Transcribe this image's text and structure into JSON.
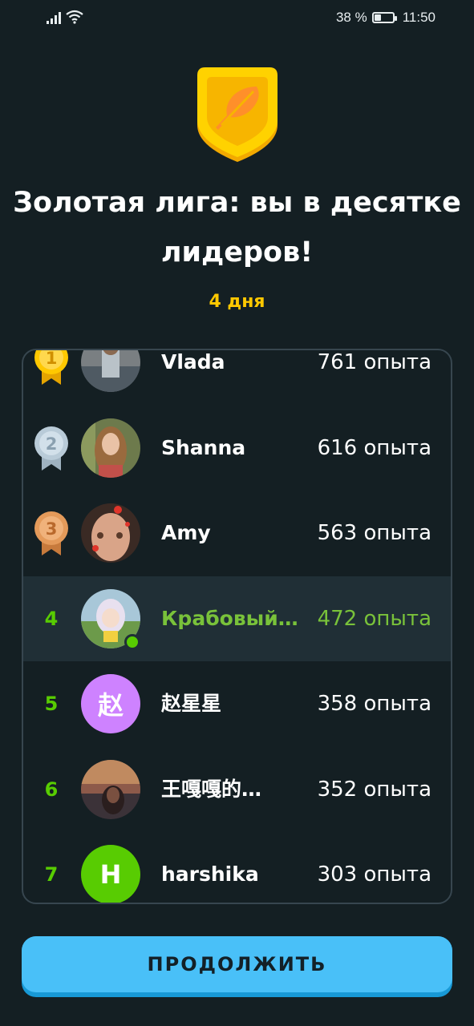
{
  "status_bar": {
    "battery": "38 %",
    "time": "11:50",
    "battery_level": 0.38
  },
  "league": {
    "title_line1": "Золотая лига: вы в десятке",
    "title_line2": "лидеров!",
    "days_left": "4 дня",
    "badge_icon": "gold-league-feather-icon",
    "colors": {
      "gold": "#ffc800",
      "green": "#58cc02",
      "bg": "#141f23",
      "button": "#49c0f8"
    }
  },
  "leaderboard": [
    {
      "rank": "1",
      "medal": "gold",
      "name": "Vlada",
      "xp": "761 опыта"
    },
    {
      "rank": "2",
      "medal": "silver",
      "name": "Shanna",
      "xp": "616 опыта"
    },
    {
      "rank": "3",
      "medal": "bronze",
      "name": "Amy",
      "xp": "563 опыта"
    },
    {
      "rank": "4",
      "medal": "",
      "name": "Крабовый…",
      "xp": "472 опыта",
      "is_current_user": true
    },
    {
      "rank": "5",
      "medal": "",
      "name": "赵星星",
      "xp": "358 опыта",
      "avatar_letter": "赵"
    },
    {
      "rank": "6",
      "medal": "",
      "name": "王嘎嘎的…",
      "xp": "352 опыта"
    },
    {
      "rank": "7",
      "medal": "",
      "name": "harshika",
      "xp": "303 опыта",
      "avatar_letter": "H"
    }
  ],
  "continue_button": {
    "label": "ПРОДОЛЖИТЬ"
  }
}
